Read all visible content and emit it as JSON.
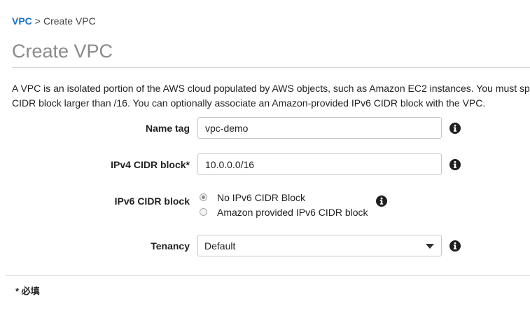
{
  "breadcrumb": {
    "root": "VPC",
    "separator": ">",
    "current": "Create VPC"
  },
  "page_title": "Create VPC",
  "description": {
    "line1": "A VPC is an isolated portion of the AWS cloud populated by AWS objects, such as Amazon EC2 instances. You must sp",
    "line2": "CIDR block larger than /16. You can optionally associate an Amazon-provided IPv6 CIDR block with the VPC."
  },
  "form": {
    "name_tag": {
      "label": "Name tag",
      "value": "vpc-demo",
      "info_icon": "info-icon"
    },
    "ipv4_cidr": {
      "label": "IPv4 CIDR block*",
      "value": "10.0.0.0/16",
      "info_icon": "info-icon"
    },
    "ipv6_cidr": {
      "label": "IPv6 CIDR block",
      "options": [
        {
          "label": "No IPv6 CIDR Block",
          "selected": true
        },
        {
          "label": "Amazon provided IPv6 CIDR block",
          "selected": false
        }
      ],
      "info_icon": "info-icon"
    },
    "tenancy": {
      "label": "Tenancy",
      "selected": "Default",
      "info_icon": "info-icon"
    }
  },
  "footer": {
    "required_note": "* 必填"
  },
  "colors": {
    "link": "#1a73c7",
    "title": "#8a8a8a",
    "icon": "#1f1f1f"
  }
}
